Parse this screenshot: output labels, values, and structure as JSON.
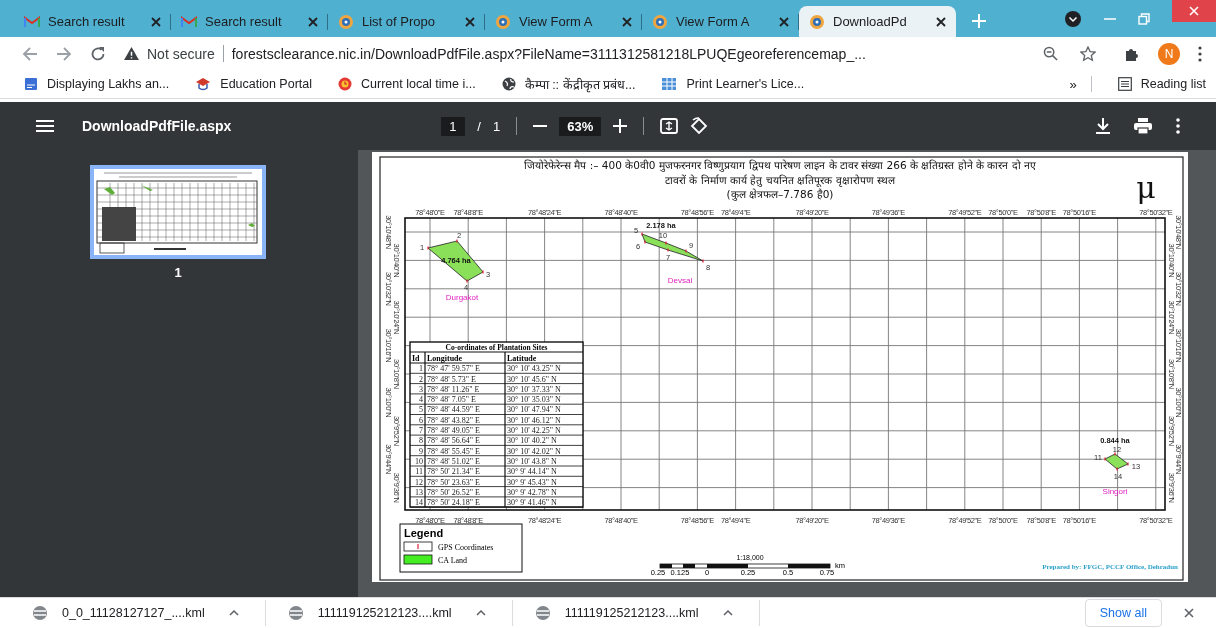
{
  "tabs": [
    {
      "title": "Search result",
      "kind": "mail",
      "selected": false
    },
    {
      "title": "Search result",
      "kind": "mail",
      "selected": false
    },
    {
      "title": "List of Propo",
      "kind": "emblem",
      "selected": false
    },
    {
      "title": "View Form A",
      "kind": "emblem",
      "selected": false
    },
    {
      "title": "View Form A",
      "kind": "emblem",
      "selected": false
    },
    {
      "title": "DownloadPd",
      "kind": "emblem",
      "selected": true
    }
  ],
  "address_bar": {
    "security": "Not secure",
    "url": "forestsclearance.nic.in/DownloadPdfFile.aspx?FileName=3111312581218LPUQEgeoreferencemap_..."
  },
  "profile": "N",
  "bookmarks": [
    {
      "label": "Displaying Lakhs an...",
      "kind": "news"
    },
    {
      "label": "Education Portal",
      "kind": "hat"
    },
    {
      "label": "Current local time i...",
      "kind": "clock"
    },
    {
      "label": "कैम्पा :: केंद्रीकृत प्रबंध...",
      "kind": "globe"
    },
    {
      "label": "Print Learner's Lice...",
      "kind": "grid"
    }
  ],
  "bookmarks_more": "»",
  "reading_list": "Reading list",
  "pdf_toolbar": {
    "file_name": "DownloadPdfFile.aspx",
    "page": "1",
    "separator": "/",
    "page_count": "1",
    "zoom": "63%"
  },
  "thumbnails": [
    {
      "label": "1",
      "selected": true
    }
  ],
  "map": {
    "title_lines": [
      "जियोरेफेरेन्स मैप :– 400 के0वी0 मुजफरनगर विष्णुप्रयाग द्विपथ पारेषण लाइन के टावर संख्या 266 के क्षतिग्रस्त होने के कारन दो नए",
      "टावरों के निर्माण कार्य हेतु चयनित क्षतिपूरक वृक्षारोपण स्थल"
    ],
    "area_note": "(कुल क्षेत्रफल–7.786 है0)",
    "north_symbol": "μ",
    "top_ticks": [
      "78°48'0\"E",
      "78°48'8\"E",
      "78°48'24\"E",
      "78°48'40\"E",
      "78°48'56\"E",
      "78°49'4\"E",
      "78°49'20\"E",
      "78°49'36\"E",
      "78°49'52\"E",
      "78°50'0\"E",
      "78°50'8\"E",
      "78°50'16\"E",
      "78°50'32\"E"
    ],
    "bottom_ticks": [
      "78°48'0\"E",
      "78°48'8\"E",
      "78°48'24\"E",
      "78°48'40\"E",
      "78°48'56\"E",
      "78°49'4\"E",
      "78°49'20\"E",
      "78°49'36\"E",
      "78°49'52\"E",
      "78°50'0\"E",
      "78°50'8\"E",
      "78°50'16\"E",
      "78°50'32\"E"
    ],
    "left_ticks": [
      "30°10'48\"N",
      "30°10'40\"N",
      "30°10'32\"N",
      "30°10'24\"N",
      "30°10'16\"N",
      "30°10'8\"N",
      "30°10'0\"N",
      "30°9'52\"N",
      "30°9'44\"N",
      "30°9'36\"N"
    ],
    "right_ticks": [
      "30°10'48\"N",
      "30°10'40\"N",
      "30°10'32\"N",
      "30°10'24\"N",
      "30°10'16\"N",
      "30°10'8\"N",
      "30°10'0\"N",
      "30°9'52\"N",
      "30°9'44\"N",
      "30°9'36\"N"
    ],
    "sites": [
      {
        "name": "Durgakot",
        "area": "4.764 ha",
        "vertices": [
          "1",
          "2",
          "3",
          "4"
        ]
      },
      {
        "name": "Devsal",
        "area": "2.178 ha",
        "vertices": [
          "5",
          "6",
          "7",
          "8",
          "9",
          "10"
        ]
      },
      {
        "name": "Singori",
        "area": "0.844 ha",
        "vertices": [
          "11",
          "12",
          "13",
          "14"
        ]
      }
    ],
    "table": {
      "title": "Co-ordinates of Plantation Sites",
      "columns": [
        "Id",
        "Longitude",
        "Latitude"
      ],
      "rows": [
        [
          "1",
          "78° 47' 59.57\" E",
          "30° 10' 43.25\" N"
        ],
        [
          "2",
          "78° 48' 5.73\" E",
          "30° 10' 45.6\" N"
        ],
        [
          "3",
          "78° 48' 11.26\" E",
          "30° 10' 37.33\" N"
        ],
        [
          "4",
          "78° 48' 7.05\" E",
          "30° 10' 35.03\" N"
        ],
        [
          "5",
          "78° 48' 44.59\" E",
          "30° 10' 47.94\" N"
        ],
        [
          "6",
          "78° 48' 43.82\" E",
          "30° 10' 46.12\" N"
        ],
        [
          "7",
          "78° 48' 49.05\" E",
          "30° 10' 42.25\" N"
        ],
        [
          "8",
          "78° 48' 56.64\" E",
          "30° 10' 40.2\" N"
        ],
        [
          "9",
          "78° 48' 55.45\" E",
          "30° 10' 42.02\" N"
        ],
        [
          "10",
          "78° 48' 51.02\" E",
          "30° 10' 43.8\" N"
        ],
        [
          "11",
          "78° 50' 21.34\" E",
          "30° 9' 44.14\" N"
        ],
        [
          "12",
          "78° 50' 23.63\" E",
          "30° 9' 45.43\" N"
        ],
        [
          "13",
          "78° 50' 26.52\" E",
          "30° 9' 42.78\" N"
        ],
        [
          "14",
          "78° 50' 24.18\" E",
          "30° 9' 41.46\" N"
        ]
      ]
    },
    "legend": {
      "title": "Legend",
      "items": [
        {
          "label": "GPS Coordinates",
          "kind": "point"
        },
        {
          "label": "CA Land",
          "kind": "area"
        }
      ]
    },
    "scale": {
      "ratio": "1:18,000",
      "labels": [
        "0.25",
        "0.125",
        "0",
        "0.25",
        "0.5",
        "0.75"
      ],
      "unit": "km"
    },
    "credit": "Prepared by: FFGC, PCCF Office, Dehradun"
  },
  "downloads": [
    {
      "file": "0_0_11128127127_....kml"
    },
    {
      "file": "111119125212123....kml"
    },
    {
      "file": "111119125212123....kml"
    }
  ],
  "show_all": "Show all"
}
